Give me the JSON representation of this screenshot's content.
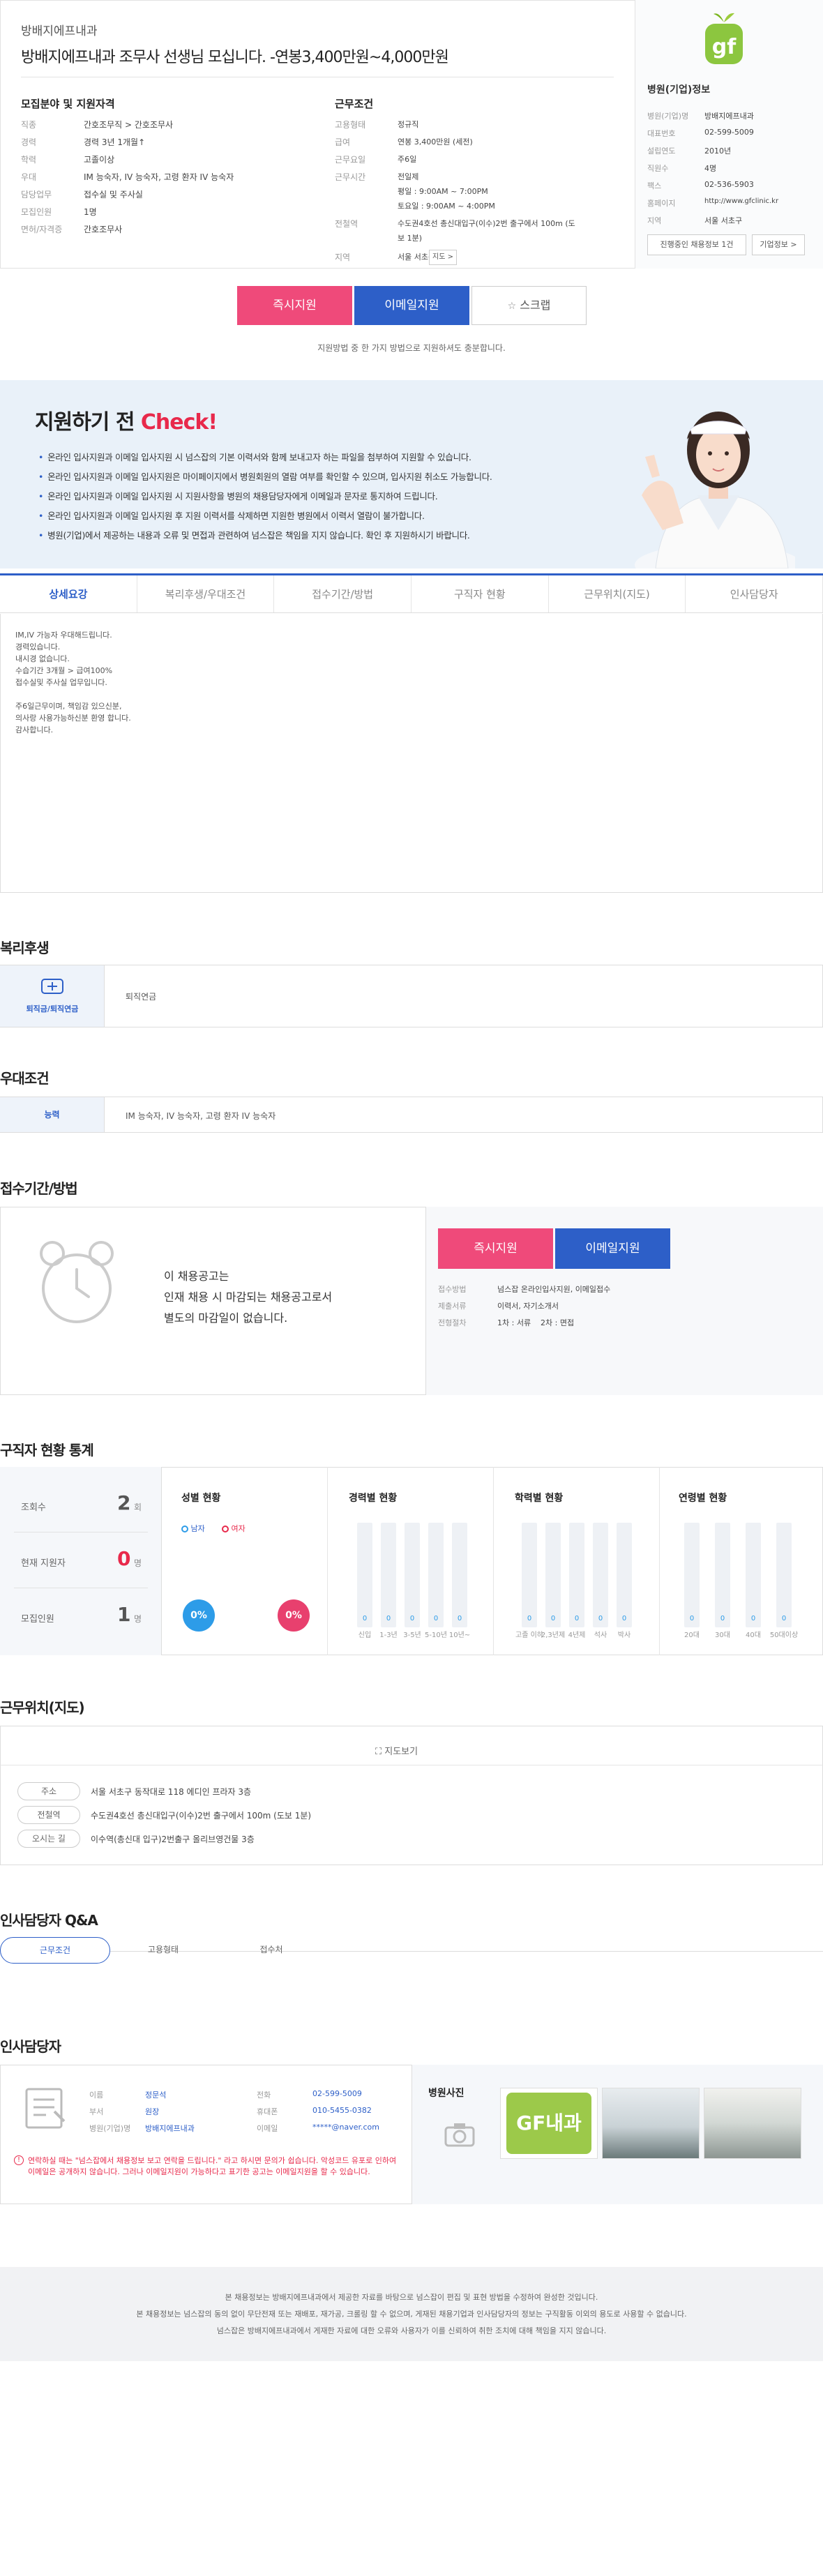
{
  "header": {
    "hospital_name": "방배지에프내과",
    "title": "방배지에프내과 조무사 선생님 모십니다. -연봉3,400만원~4,000만원"
  },
  "recruit": {
    "title": "모집분야 및 지원자격",
    "rows": [
      {
        "k": "직종",
        "v": "간호조무직 > 간호조무사"
      },
      {
        "k": "경력",
        "v": "경력 3년 1개월↑"
      },
      {
        "k": "학력",
        "v": "고졸이상"
      },
      {
        "k": "우대",
        "v": "IM 능숙자, IV 능숙자, 고령 환자 IV 능숙자"
      },
      {
        "k": "담당업무",
        "v": "접수실 및 주사실"
      },
      {
        "k": "모집인원",
        "v": "1명"
      },
      {
        "k": "면허/자격증",
        "v": "간호조무사"
      }
    ]
  },
  "conditions": {
    "title": "근무조건",
    "rows": [
      {
        "k": "고용형태",
        "v": "정규직"
      },
      {
        "k": "급여",
        "v": "연봉 3,400만원 (세전)"
      },
      {
        "k": "근무요일",
        "v": "주6일"
      },
      {
        "k": "근무시간",
        "v": "전일제"
      },
      {
        "k": "",
        "v": "평일 : 9:00AM ~ 7:00PM"
      },
      {
        "k": "",
        "v": "토요일 : 9:00AM ~ 4:00PM"
      },
      {
        "k": "전철역",
        "v": "수도권4호선 총신대입구(이수)2번 출구에서 100m (도"
      },
      {
        "k": "",
        "v": "보 1분)"
      },
      {
        "k": "지역",
        "v": "서울 서초구"
      }
    ],
    "map_btn": "지도 >"
  },
  "hospital_info": {
    "title": "병원(기업)정보",
    "rows": [
      {
        "k": "병원(기업)명",
        "v": "방배지에프내과"
      },
      {
        "k": "대표번호",
        "v": "02-599-5009"
      },
      {
        "k": "설립연도",
        "v": "2010년"
      },
      {
        "k": "직원수",
        "v": "4명"
      },
      {
        "k": "팩스",
        "v": "02-536-5903"
      },
      {
        "k": "홈페이지",
        "v": "http://www.gfclinic.kr"
      },
      {
        "k": "지역",
        "v": "서울 서초구"
      }
    ],
    "btn_ongoing": "진행중인 채용정보 1건",
    "btn_info": "기업정보 >",
    "logo_text": "gf"
  },
  "apply": {
    "instant": "즉시지원",
    "email": "이메일지원",
    "scrap": "스크랩",
    "note": "지원방법 중 한 가지 방법으로 지원하셔도 충분합니다."
  },
  "check": {
    "title_a": "지원하기 전",
    "title_b": "Check!",
    "items": [
      "온라인 입사지원과 이메일 입사지원 시 넘스잡의 기본 이력서와 함께 보내고자 하는 파일을 첨부하여 지원할 수 있습니다.",
      "온라인 입사지원과 이메일 입사지원은 마이페이지에서 병원회원의 열람 여부를 확인할 수 있으며, 입사지원 취소도 가능합니다.",
      "온라인 입사지원과 이메일 입사지원 시 지원사항을 병원의 채용담당자에게 이메일과 문자로 통지하여 드립니다.",
      "온라인 입사지원과 이메일 입사지원 후 지원 이력서를 삭제하면 지원한 병원에서 이력서 열람이 불가합니다.",
      "병원(기업)에서 제공하는 내용과 오류 및 면접과 관련하여 넘스잡은 책임을 지지 않습니다. 확인 후 지원하시기 바랍니다."
    ]
  },
  "tabs": [
    "상세요강",
    "복리후생/우대조건",
    "접수기간/방법",
    "구직자 현황",
    "근무위치(지도)",
    "인사담당자"
  ],
  "detail_lines": [
    "IM,IV 가능자 우대해드립니다.",
    "경력있습니다.",
    "내시경 없습니다.",
    "수습기간 3개월 > 급여100%",
    "접수실및 주사실 업무입니다.",
    "",
    "주6일근무이며, 책임감 있으신분,",
    "의사랑 사용가능하신분 환영 합니다.",
    "감사합니다."
  ],
  "welfare": {
    "title": "복리후생",
    "icon_label": "퇴직금/퇴직연금",
    "value": "퇴직연금"
  },
  "prefer": {
    "title": "우대조건",
    "label": "능력",
    "value": "IM 능숙자, IV 능숙자, 고령 환자 IV 능숙자"
  },
  "period": {
    "title": "접수기간/방법",
    "closed_msg": [
      "이 채용공고는",
      "인재 채용 시 마감되는 채용공고로서",
      "별도의 마감일이 없습니다."
    ],
    "instant": "즉시지원",
    "email": "이메일지원",
    "rows": [
      {
        "k": "접수방법",
        "v": "넘스잡 온라인입사지원, 이메일접수"
      },
      {
        "k": "제출서류",
        "v": "이력서, 자기소개서"
      },
      {
        "k": "전형절차",
        "v": "1차 : 서류    2차 : 면접"
      }
    ]
  },
  "stats": {
    "title": "구직자 현황 통계",
    "left": [
      {
        "k": "조회수",
        "v": "2",
        "u": "회"
      },
      {
        "k": "현재 지원자",
        "v": "0",
        "u": "명"
      },
      {
        "k": "모집인원",
        "v": "1",
        "u": "명"
      }
    ],
    "gender": {
      "title": "성별 현황",
      "male": "남자",
      "female": "여자",
      "male_pct": "0%",
      "female_pct": "0%"
    },
    "career": {
      "title": "경력별 현황",
      "labels": [
        "신입",
        "1-3년",
        "3-5년",
        "5-10년",
        "10년~"
      ],
      "values": [
        0,
        0,
        0,
        0,
        0
      ]
    },
    "edu": {
      "title": "학력별 현황",
      "labels": [
        "고졸 이하",
        "2,3년제",
        "4년제",
        "석사",
        "박사"
      ],
      "values": [
        0,
        0,
        0,
        0,
        0
      ]
    },
    "age": {
      "title": "연령별 현황",
      "labels": [
        "20대",
        "30대",
        "40대",
        "50대이상"
      ],
      "values": [
        0,
        0,
        0,
        0
      ]
    }
  },
  "location": {
    "title": "근무위치(지도)",
    "map_btn": "지도보기",
    "rows": [
      {
        "k": "주소",
        "v": "서울 서초구 동작대로 118 에디인 프라자 3층"
      },
      {
        "k": "전철역",
        "v": "수도권4호선 총신대입구(이수)2번 출구에서 100m (도보 1분)"
      },
      {
        "k": "오시는 길",
        "v": "이수역(총신대 입구)2번출구 올리브영건물 3층"
      }
    ]
  },
  "qa": {
    "title": "인사담당자 Q&A",
    "tabs": [
      "근무조건",
      "고용형태",
      "접수처"
    ]
  },
  "manager": {
    "title": "인사담당자",
    "rows_left": [
      {
        "k": "이름",
        "v": "정문석"
      },
      {
        "k": "부서",
        "v": "원장"
      },
      {
        "k": "병원(기업)명",
        "v": "방배지에프내과"
      }
    ],
    "rows_right": [
      {
        "k": "전화",
        "v": "02-599-5009"
      },
      {
        "k": "휴대폰",
        "v": "010-5455-0382"
      },
      {
        "k": "이메일",
        "v": "*****@naver.com"
      }
    ],
    "notice": "연락하실 때는 \"넘스잡에서 채용정보 보고 연락을 드립니다.\" 라고 하시면 문의가 쉽습니다. 악성코드 유포로 인하여 이메일은 공개하지 않습니다. 그러나 이메일지원이 가능하다고 표기한 공고는 이메일지원을 할 수 있습니다.",
    "photos_title": "병원사진",
    "photo_logo": "GF내과"
  },
  "footer": [
    "본 채용정보는 방배지에프내과에서 제공한 자료를 바탕으로 넘스잡이 편집 및 표현 방법을 수정하여 완성한 것입니다.",
    "본 채용정보는 넘스잡의 동의 없이 무단전재 또는 재배포, 재가공, 크롤링 할 수 없으며, 게재된 채용기업과 인사담당자의 정보는 구직활동 이외의 용도로 사용할 수 없습니다.",
    "넘스잡은 방배지에프내과에서 게재한 자료에 대한 오류와 사용자가 이를 신뢰하여 취한 조치에 대해 책임을 지지 않습니다."
  ],
  "colors": {
    "accent": "#2d5fc8",
    "red": "#e8294b",
    "pink": "#ef4a7a"
  }
}
